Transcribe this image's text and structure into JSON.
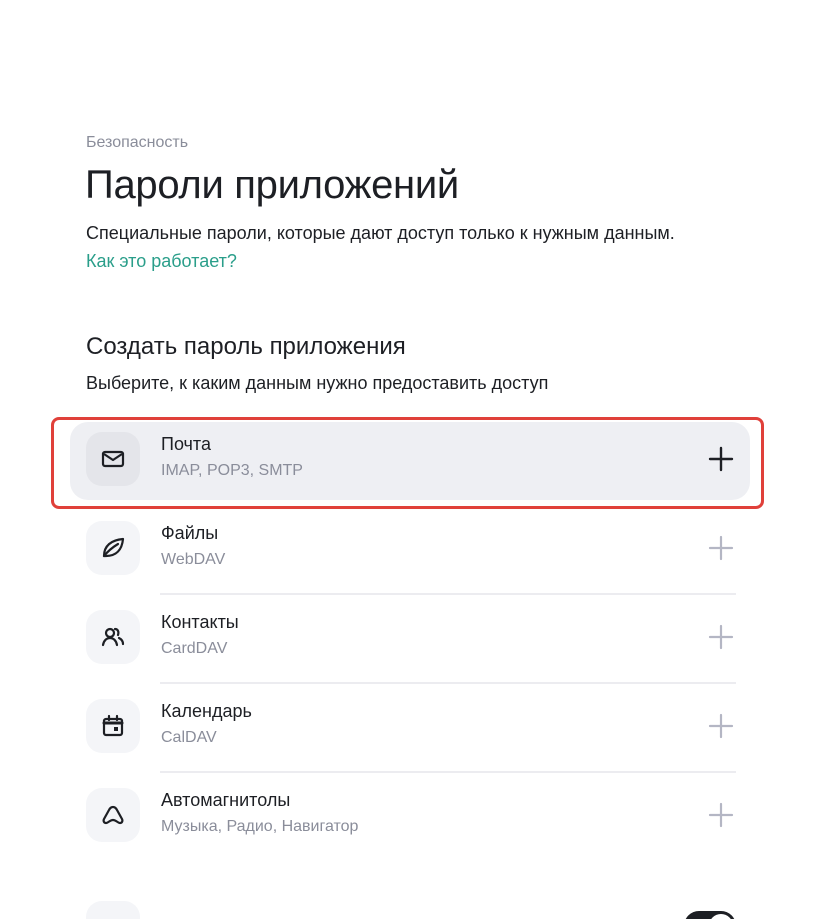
{
  "header": {
    "breadcrumb": "Безопасность",
    "title": "Пароли приложений",
    "description": "Специальные пароли, которые дают доступ только к нужным данным.",
    "help_link": "Как это работает?"
  },
  "create_section": {
    "title": "Создать пароль приложения",
    "subtitle": "Выберите, к каким данным нужно предоставить доступ",
    "items": [
      {
        "title": "Почта",
        "subtitle": "IMAP, POP3, SMTP",
        "icon": "mail-icon"
      },
      {
        "title": "Файлы",
        "subtitle": "WebDAV",
        "icon": "files-leaf-icon"
      },
      {
        "title": "Контакты",
        "subtitle": "CardDAV",
        "icon": "contacts-icon"
      },
      {
        "title": "Календарь",
        "subtitle": "CalDAV",
        "icon": "calendar-icon"
      },
      {
        "title": "Автомагнитолы",
        "subtitle": "Музыка, Радио, Навигатор",
        "icon": "car-audio-icon"
      }
    ]
  },
  "colors": {
    "text": "#1d1f24",
    "muted": "#8a8d9a",
    "link": "#2a9e8a",
    "hover_bg": "#eeeff3",
    "highlight_border": "#e0403a",
    "plus_muted": "#b4b6c4"
  }
}
